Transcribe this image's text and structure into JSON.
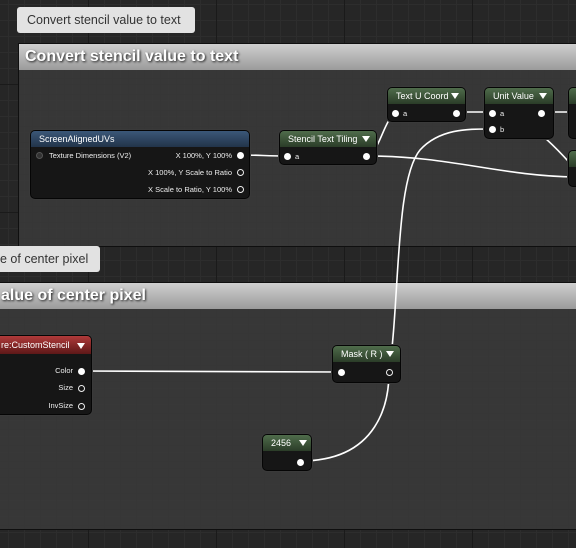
{
  "comments": {
    "top": {
      "bubble": "Convert stencil value to text",
      "header": "Convert stencil value to text"
    },
    "bottom": {
      "bubble": "e of center pixel",
      "header": "alue of center pixel"
    }
  },
  "nodes": {
    "screen_aligned_uvs": {
      "title": "ScreenAlignedUVs",
      "input_label": "Texture Dimensions (V2)",
      "outputs": [
        "X 100%, Y 100%",
        "X 100%, Y Scale to Ratio",
        "X Scale to Ratio, Y 100%"
      ]
    },
    "stencil_text_tiling": {
      "title": "Stencil Text Tiling",
      "input": "a"
    },
    "text_u_coord": {
      "title": "Text U Coord",
      "input": "a"
    },
    "unit_value": {
      "title": "Unit Value",
      "inputs": [
        "a",
        "b"
      ]
    },
    "custom_stencil": {
      "title": "re:CustomStencil",
      "outputs": [
        "Color",
        "Size",
        "InvSize"
      ]
    },
    "mask": {
      "title": "Mask ( R )"
    },
    "constant": {
      "title": "2456"
    }
  },
  "colors": {
    "comment_header": "#b4b4b4",
    "node_title_green": "#3d5439",
    "node_title_blue": "#2f4661",
    "node_title_red": "#8a2a2a",
    "wire": "#ffffff"
  }
}
